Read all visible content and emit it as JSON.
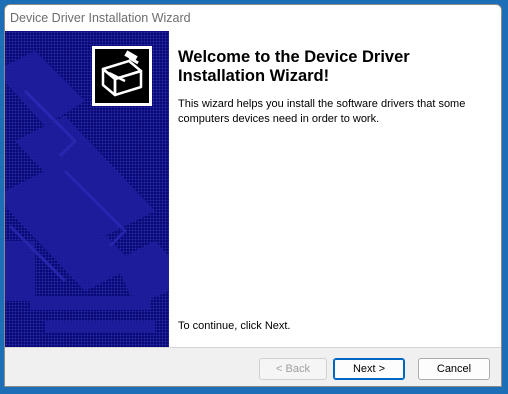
{
  "window": {
    "title": "Device Driver Installation Wizard"
  },
  "banner": {
    "logo_icon": "hardware-device-icon",
    "colors": {
      "background": "#0a0a78",
      "shapes": "#1e1e9e"
    }
  },
  "main": {
    "heading": "Welcome to the Device Driver Installation Wizard!",
    "description": "This wizard helps you install the software drivers that some computers devices need in order to work.",
    "continue_text": "To continue, click Next."
  },
  "buttons": {
    "back_label": "< Back",
    "next_label": "Next >",
    "cancel_label": "Cancel"
  }
}
